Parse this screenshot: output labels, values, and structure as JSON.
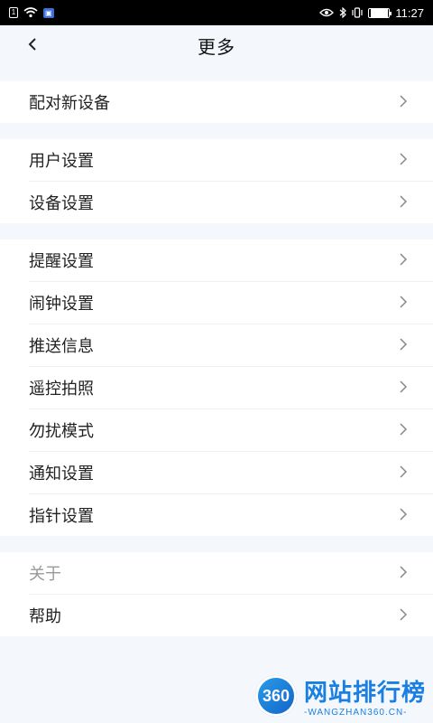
{
  "status_bar": {
    "time": "11:27",
    "left_icons": [
      "sim-icon",
      "wifi-icon",
      "badge-icon"
    ],
    "right_icons": [
      "eye-icon",
      "bluetooth-icon",
      "vibrate-icon",
      "battery-icon"
    ],
    "battery_level": 0.9
  },
  "header": {
    "title": "更多",
    "back_label": "<"
  },
  "sections": [
    {
      "items": [
        {
          "label": "配对新设备"
        }
      ]
    },
    {
      "items": [
        {
          "label": "用户设置"
        },
        {
          "label": "设备设置"
        }
      ]
    },
    {
      "items": [
        {
          "label": "提醒设置"
        },
        {
          "label": "闹钟设置"
        },
        {
          "label": "推送信息"
        },
        {
          "label": "遥控拍照"
        },
        {
          "label": "勿扰模式"
        },
        {
          "label": "通知设置"
        },
        {
          "label": "指针设置"
        }
      ]
    },
    {
      "items": [
        {
          "label": "关于",
          "disabled": true
        },
        {
          "label": "帮助"
        }
      ]
    }
  ],
  "watermark": {
    "logo_text": "360",
    "title": "网站排行榜",
    "subtitle": "-WANGZHAN360.CN-"
  }
}
